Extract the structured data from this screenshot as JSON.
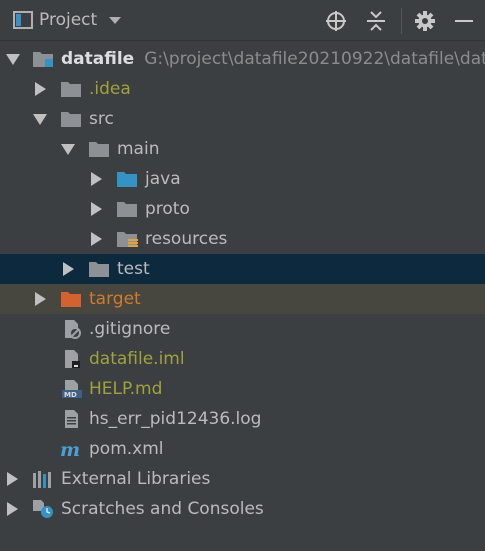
{
  "header": {
    "title": "Project",
    "icons": [
      "project-window-icon",
      "chevron-down-icon",
      "locate-icon",
      "collapse-all-icon",
      "gear-icon",
      "minimize-icon"
    ]
  },
  "tree": {
    "root": {
      "name": "datafile",
      "path": "G:\\project\\datafile20210922\\datafile\\dat"
    },
    "idea": ".idea",
    "src": "src",
    "main": "main",
    "java": "java",
    "proto": "proto",
    "resources": "resources",
    "test": "test",
    "target": "target",
    "gitignore": ".gitignore",
    "iml": "datafile.iml",
    "help": "HELP.md",
    "log": "hs_err_pid12436.log",
    "pom": "pom.xml",
    "external": "External Libraries",
    "scratches": "Scratches and Consoles"
  },
  "colors": {
    "background": "#3c3f41",
    "selected_row": "#0d293e",
    "excluded_row": "#47463f",
    "text": "#bbbbbb",
    "olive_text": "#a2a13b",
    "orange_text": "#d07c2c",
    "folder": "#8d9094",
    "source_folder": "#3592c4",
    "excluded_folder": "#d3622d"
  }
}
